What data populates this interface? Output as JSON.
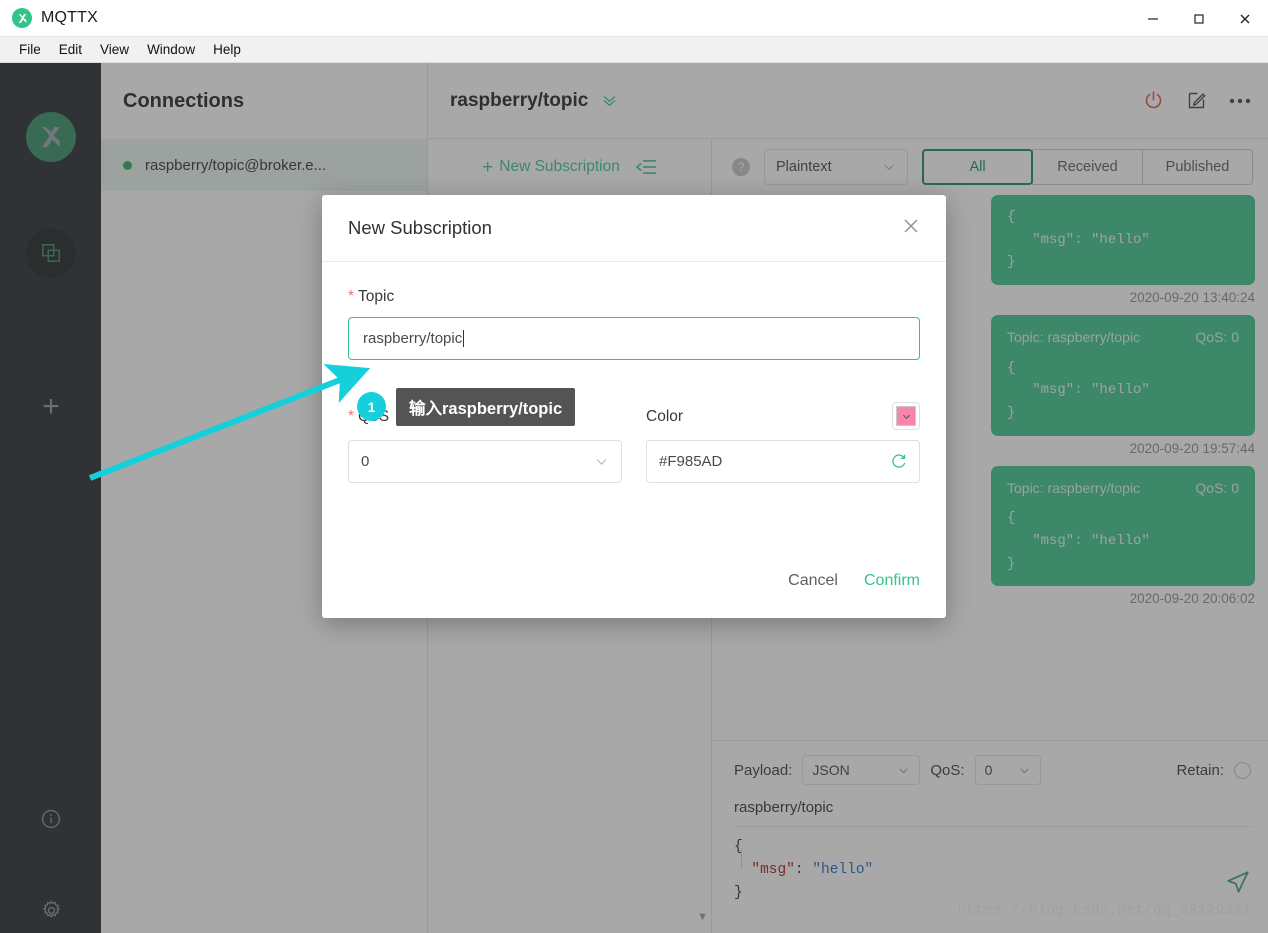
{
  "window": {
    "app_title": "MQTTX",
    "logo_icon": "mqttx-logo-icon",
    "minimize_icon": "minimize-icon",
    "maximize_icon": "maximize-icon",
    "close_icon": "close-icon"
  },
  "menubar": {
    "items": [
      {
        "label": "File"
      },
      {
        "label": "Edit"
      },
      {
        "label": "View"
      },
      {
        "label": "Window"
      },
      {
        "label": "Help"
      }
    ]
  },
  "rail": {
    "logo_icon": "mqttx-logo-icon",
    "items": [
      {
        "name": "connections-icon",
        "active": true
      },
      {
        "name": "add-connection-plus-icon",
        "label": "+"
      },
      {
        "name": "info-icon"
      },
      {
        "name": "settings-gear-icon"
      }
    ]
  },
  "connections": {
    "title": "Connections",
    "items": [
      {
        "name": "raspberry/topic@broker.e...",
        "status": "connected"
      }
    ]
  },
  "main_header": {
    "title": "raspberry/topic",
    "chevron_icon": "double-chevron-down-icon",
    "actions": [
      {
        "name": "disconnect-power-icon",
        "color": "#e74c3c"
      },
      {
        "name": "edit-icon"
      },
      {
        "name": "more-options-icon"
      }
    ]
  },
  "subscription_toolbar": {
    "new_subscription_label": "New Subscription",
    "plus": "+",
    "collapse_icon": "collapse-list-icon"
  },
  "message_toolbar": {
    "help_icon": "help-question-icon",
    "help_glyph": "?",
    "format_select": {
      "value": "Plaintext",
      "chevron": "chevron-down-icon"
    },
    "tabs": [
      {
        "label": "All",
        "active": true
      },
      {
        "label": "Received",
        "active": false
      },
      {
        "label": "Published",
        "active": false
      }
    ]
  },
  "messages": [
    {
      "meta_topic": "",
      "meta_qos": "",
      "show_meta": false,
      "body": "{\n   \"msg\": \"hello\"\n}",
      "time": "2020-09-20 13:40:24"
    },
    {
      "meta_topic": "Topic: raspberry/topic",
      "meta_qos": "QoS: 0",
      "show_meta": true,
      "body": "{\n   \"msg\": \"hello\"\n}",
      "time": "2020-09-20 19:57:44"
    },
    {
      "meta_topic": "Topic: raspberry/topic",
      "meta_qos": "QoS: 0",
      "show_meta": true,
      "body": "{\n   \"msg\": \"hello\"\n}",
      "time": "2020-09-20 20:06:02"
    }
  ],
  "publish": {
    "payload_label": "Payload:",
    "payload_value": "JSON",
    "qos_label": "QoS:",
    "qos_value": "0",
    "retain_label": "Retain:",
    "retain_on": false,
    "topic": "raspberry/topic",
    "editor": {
      "line1": "{",
      "key": "\"msg\"",
      "colon": ": ",
      "value": "\"hello\"",
      "line3": "}"
    },
    "send_icon": "send-paper-plane-icon"
  },
  "watermark": "https://blog.csdn.net/qq_38129331",
  "modal": {
    "title": "New Subscription",
    "close_icon": "close-icon",
    "topic_label": "Topic",
    "topic_value": "raspberry/topic",
    "qos_label": "QoS",
    "qos_value": "0",
    "color_label": "Color",
    "color_value": "#F985AD",
    "color_hex": "#F985AD",
    "refresh_icon": "refresh-color-icon",
    "swatch_chevron_icon": "chevron-down-icon",
    "qos_chevron_icon": "chevron-down-icon",
    "cancel_label": "Cancel",
    "confirm_label": "Confirm"
  },
  "annotation": {
    "step_number": "1",
    "tooltip_text": "输入raspberry/topic",
    "arrow_color": "#15d0db"
  },
  "colors": {
    "brand_green": "#34c388",
    "rail_bg": "#1d2027",
    "accent_cyan": "#15d0db",
    "pink": "#F985AD",
    "danger_red": "#e74c3c"
  }
}
